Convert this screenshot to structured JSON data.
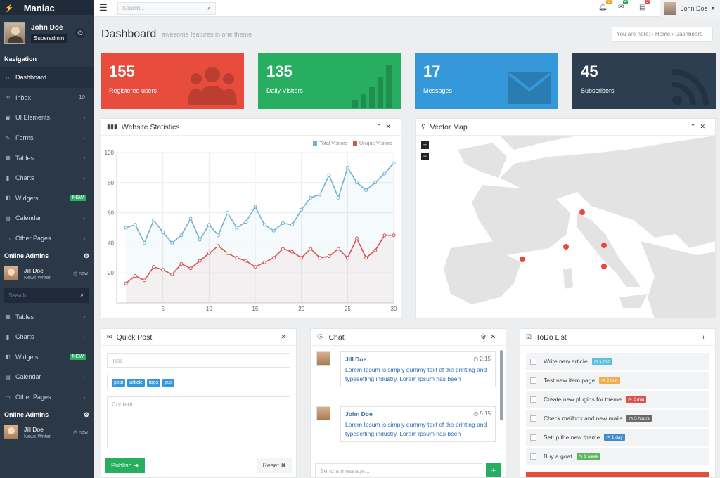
{
  "brand": {
    "name": "Maniac"
  },
  "user": {
    "name": "John Doe",
    "role": "Superadmin"
  },
  "nav": {
    "title": "Navigation",
    "items": [
      {
        "label": "Dashboard",
        "active": true
      },
      {
        "label": "Inbox",
        "count": "10"
      },
      {
        "label": "UI Elements"
      },
      {
        "label": "Forms"
      },
      {
        "label": "Tables"
      },
      {
        "label": "Charts"
      },
      {
        "label": "Widgets",
        "badge": "NEW"
      },
      {
        "label": "Calendar"
      },
      {
        "label": "Other Pages"
      }
    ],
    "items2": [
      {
        "label": "Tables"
      },
      {
        "label": "Charts"
      },
      {
        "label": "Widgets",
        "badge": "NEW"
      },
      {
        "label": "Calendar"
      },
      {
        "label": "Other Pages"
      }
    ]
  },
  "online_admins": {
    "title": "Online Admins",
    "admin": {
      "name": "Jill Doe",
      "title": "News Writer",
      "status": "now"
    }
  },
  "side_search": {
    "placeholder": "Search..."
  },
  "topbar": {
    "search_placeholder": "Search...",
    "notifications": [
      {
        "count": "3",
        "color": "#f39c12"
      },
      {
        "count": "4",
        "color": "#27ae60"
      },
      {
        "count": "3",
        "color": "#e74c3c"
      }
    ],
    "user_name": "John Doe"
  },
  "page": {
    "title": "Dashboard",
    "subtitle": "awesome features in one theme",
    "breadcrumb": "You are here: › Home › Dashboard"
  },
  "stats": [
    {
      "value": "155",
      "label": "Registered users",
      "color": "#e74c3c",
      "icon": "users-icon"
    },
    {
      "value": "135",
      "label": "Daily Visitors",
      "color": "#27ae60",
      "icon": "bar-chart-icon"
    },
    {
      "value": "17",
      "label": "Messages",
      "color": "#3498db",
      "icon": "envelope-icon"
    },
    {
      "value": "45",
      "label": "Subscribers",
      "color": "#2c3e50",
      "icon": "rss-icon"
    }
  ],
  "website_stats": {
    "title": "Website Statistics",
    "legend": [
      "Total Visitors",
      "Unique Visitors"
    ]
  },
  "chart_data": {
    "type": "line",
    "x": [
      1,
      2,
      3,
      4,
      5,
      6,
      7,
      8,
      9,
      10,
      11,
      12,
      13,
      14,
      15,
      16,
      17,
      18,
      19,
      20,
      21,
      22,
      23,
      24,
      25,
      26,
      27,
      28,
      29,
      30
    ],
    "xticks": [
      5,
      10,
      15,
      20,
      25,
      30
    ],
    "yticks": [
      20,
      40,
      60,
      80,
      100
    ],
    "ylim": [
      0,
      100
    ],
    "xlim": [
      0,
      30
    ],
    "series": [
      {
        "name": "Total Visitors",
        "color": "#6fb3d2",
        "values": [
          50,
          52,
          40,
          55,
          47,
          40,
          45,
          56,
          42,
          52,
          45,
          60,
          50,
          54,
          64,
          52,
          48,
          53,
          52,
          62,
          70,
          72,
          85,
          70,
          90,
          80,
          75,
          80,
          86,
          93
        ]
      },
      {
        "name": "Unique Visitors",
        "color": "#d9534f",
        "values": [
          13,
          18,
          15,
          24,
          22,
          19,
          26,
          23,
          28,
          33,
          38,
          33,
          30,
          28,
          24,
          27,
          30,
          36,
          34,
          30,
          36,
          30,
          31,
          36,
          30,
          43,
          30,
          35,
          45,
          45
        ]
      }
    ]
  },
  "vector_map": {
    "title": "Vector Map",
    "zoom_in": "+",
    "zoom_out": "−"
  },
  "quick_post": {
    "title": "Quick Post",
    "title_placeholder": "Title",
    "tags": [
      "post",
      "article",
      "tags",
      "pus"
    ],
    "content_placeholder": "Content",
    "publish_label": "Publish",
    "reset_label": "Reset"
  },
  "chat": {
    "title": "Chat",
    "messages": [
      {
        "name": "Jill Doe",
        "time": "2:15",
        "text": "Lorem Ipsum is simply dummy text of the printing and typesetting industry. Lorem Ipsum has been"
      },
      {
        "name": "John Doe",
        "time": "5:15",
        "text": "Lorem Ipsum is simply dummy text of the printing and typesetting industry. Lorem Ipsum has been"
      }
    ],
    "input_placeholder": "Send a message..."
  },
  "todo": {
    "title": "ToDo List",
    "items": [
      {
        "text": "Write new article",
        "badge": "1 min",
        "color": "#5bc0de"
      },
      {
        "text": "Test new item page",
        "badge": "2 min",
        "color": "#f0ad4e"
      },
      {
        "text": "Create new plugins for theme",
        "badge": "2 min",
        "color": "#d9534f"
      },
      {
        "text": "Check mailbox and new mails",
        "badge": "3 hours",
        "color": "#6b6b6b"
      },
      {
        "text": "Setup the new theme",
        "badge": "1 day",
        "color": "#428bca"
      },
      {
        "text": "Buy a goat",
        "badge": "1 week",
        "color": "#5cb85c"
      }
    ]
  }
}
